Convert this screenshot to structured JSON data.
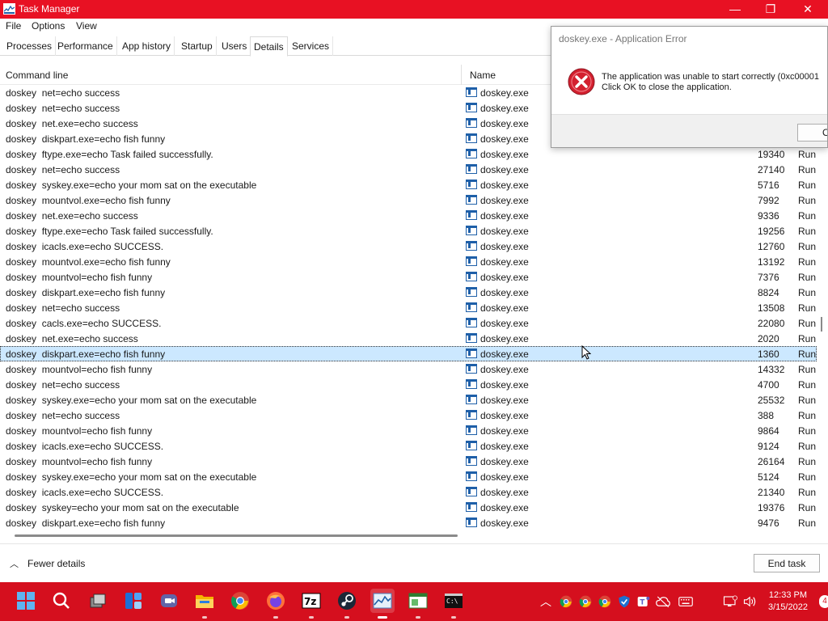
{
  "window": {
    "title": "Task Manager",
    "controls": {
      "minimize": "—",
      "maximize": "❐",
      "close": "✕"
    }
  },
  "menu": [
    "File",
    "Options",
    "View"
  ],
  "tabs": [
    "Processes",
    "Performance",
    "App history",
    "Startup",
    "Users",
    "Details",
    "Services"
  ],
  "active_tab": "Details",
  "columns": {
    "command_line": "Command line",
    "name": "Name"
  },
  "rows": [
    {
      "cmd": "doskey  net=echo success",
      "name": "doskey.exe",
      "pid": "",
      "status": ""
    },
    {
      "cmd": "doskey  net=echo success",
      "name": "doskey.exe",
      "pid": "",
      "status": ""
    },
    {
      "cmd": "doskey  net.exe=echo success",
      "name": "doskey.exe",
      "pid": "",
      "status": ""
    },
    {
      "cmd": "doskey  diskpart.exe=echo fish funny",
      "name": "doskey.exe",
      "pid": "",
      "status": ""
    },
    {
      "cmd": "doskey  ftype.exe=echo Task failed successfully.",
      "name": "doskey.exe",
      "pid": "19340",
      "status": "Run"
    },
    {
      "cmd": "doskey  net=echo success",
      "name": "doskey.exe",
      "pid": "27140",
      "status": "Run"
    },
    {
      "cmd": "doskey  syskey.exe=echo your mom sat on the executable",
      "name": "doskey.exe",
      "pid": "5716",
      "status": "Run"
    },
    {
      "cmd": "doskey  mountvol.exe=echo fish funny",
      "name": "doskey.exe",
      "pid": "7992",
      "status": "Run"
    },
    {
      "cmd": "doskey  net.exe=echo success",
      "name": "doskey.exe",
      "pid": "9336",
      "status": "Run"
    },
    {
      "cmd": "doskey  ftype.exe=echo Task failed successfully.",
      "name": "doskey.exe",
      "pid": "19256",
      "status": "Run"
    },
    {
      "cmd": "doskey  icacls.exe=echo SUCCESS.",
      "name": "doskey.exe",
      "pid": "12760",
      "status": "Run"
    },
    {
      "cmd": "doskey  mountvol.exe=echo fish funny",
      "name": "doskey.exe",
      "pid": "13192",
      "status": "Run"
    },
    {
      "cmd": "doskey  mountvol=echo fish funny",
      "name": "doskey.exe",
      "pid": "7376",
      "status": "Run"
    },
    {
      "cmd": "doskey  diskpart.exe=echo fish funny",
      "name": "doskey.exe",
      "pid": "8824",
      "status": "Run"
    },
    {
      "cmd": "doskey  net=echo success",
      "name": "doskey.exe",
      "pid": "13508",
      "status": "Run"
    },
    {
      "cmd": "doskey  cacls.exe=echo SUCCESS.",
      "name": "doskey.exe",
      "pid": "22080",
      "status": "Run"
    },
    {
      "cmd": "doskey  net.exe=echo success",
      "name": "doskey.exe",
      "pid": "2020",
      "status": "Run"
    },
    {
      "cmd": "doskey  diskpart.exe=echo fish funny",
      "name": "doskey.exe",
      "pid": "1360",
      "status": "Run"
    },
    {
      "cmd": "doskey  mountvol=echo fish funny",
      "name": "doskey.exe",
      "pid": "14332",
      "status": "Run"
    },
    {
      "cmd": "doskey  net=echo success",
      "name": "doskey.exe",
      "pid": "4700",
      "status": "Run"
    },
    {
      "cmd": "doskey  syskey.exe=echo your mom sat on the executable",
      "name": "doskey.exe",
      "pid": "25532",
      "status": "Run"
    },
    {
      "cmd": "doskey  net=echo success",
      "name": "doskey.exe",
      "pid": "388",
      "status": "Run"
    },
    {
      "cmd": "doskey  mountvol=echo fish funny",
      "name": "doskey.exe",
      "pid": "9864",
      "status": "Run"
    },
    {
      "cmd": "doskey  icacls.exe=echo SUCCESS.",
      "name": "doskey.exe",
      "pid": "9124",
      "status": "Run"
    },
    {
      "cmd": "doskey  mountvol=echo fish funny",
      "name": "doskey.exe",
      "pid": "26164",
      "status": "Run"
    },
    {
      "cmd": "doskey  syskey.exe=echo your mom sat on the executable",
      "name": "doskey.exe",
      "pid": "5124",
      "status": "Run"
    },
    {
      "cmd": "doskey  icacls.exe=echo SUCCESS.",
      "name": "doskey.exe",
      "pid": "21340",
      "status": "Run"
    },
    {
      "cmd": "doskey  syskey=echo your mom sat on the executable",
      "name": "doskey.exe",
      "pid": "19376",
      "status": "Run"
    },
    {
      "cmd": "doskey  diskpart.exe=echo fish funny",
      "name": "doskey.exe",
      "pid": "9476",
      "status": "Run"
    }
  ],
  "selected_row_index": 17,
  "footer": {
    "fewer_details": "Fewer details",
    "end_task": "End task"
  },
  "dialog": {
    "title": "doskey.exe - Application Error",
    "message_line1": "The application was unable to start correctly (0xc00001",
    "message_line2": "Click OK to close the application.",
    "ok": "OK",
    "icon": "error-icon"
  },
  "taskbar": {
    "apps": [
      "start",
      "search",
      "task-view",
      "widgets",
      "teams-chat",
      "file-explorer",
      "chrome",
      "firefox",
      "7zip",
      "steam",
      "task-manager",
      "app-window",
      "terminal"
    ],
    "clock": {
      "time": "12:33 PM",
      "date": "3/15/2022"
    },
    "notifications": "4"
  },
  "colors": {
    "titlebar": "#e81123",
    "taskbar": "#d50f1e",
    "selection": "#cce8ff",
    "error_red": "#d3202f"
  }
}
